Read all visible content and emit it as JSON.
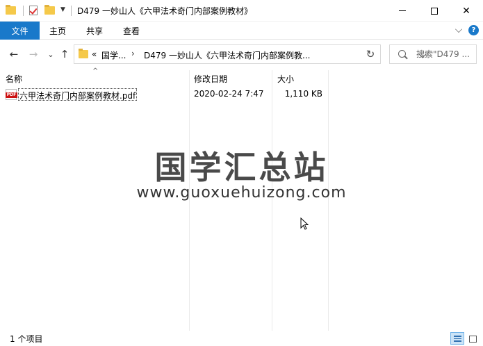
{
  "window": {
    "title": "D479 一妙山人《六甲法术奇门内部案例教材》",
    "controls": {
      "minimize": "—",
      "maximize": "☐",
      "close": "✕"
    }
  },
  "ribbon": {
    "file_tab": "文件",
    "tabs": [
      "主页",
      "共享",
      "查看"
    ],
    "help": "?"
  },
  "nav": {
    "back": "←",
    "forward": "→",
    "recent": "⌄",
    "up": "↑",
    "refresh": "↻"
  },
  "address": {
    "prefix": "«",
    "crumb1": "国学...",
    "separator": "›",
    "crumb2": "D479 一妙山人《六甲法术奇门内部案例教..."
  },
  "search": {
    "placeholder": "搜索\"D479 ..."
  },
  "columns": {
    "name": "名称",
    "date": "修改日期",
    "size": "大小"
  },
  "files": [
    {
      "name": "六甲法术奇门内部案例教材.pdf",
      "date": "2020-02-24 7:47",
      "size": "1,110 KB",
      "icon": "pdf-icon"
    }
  ],
  "watermark": {
    "logo": "国学汇总站",
    "url": "www.guoxuehuizong.com"
  },
  "status": {
    "count": "1 个项目"
  },
  "colors": {
    "accent": "#1979ca",
    "pdf_red": "#cc1111",
    "folder_yellow": "#f5c94a"
  }
}
